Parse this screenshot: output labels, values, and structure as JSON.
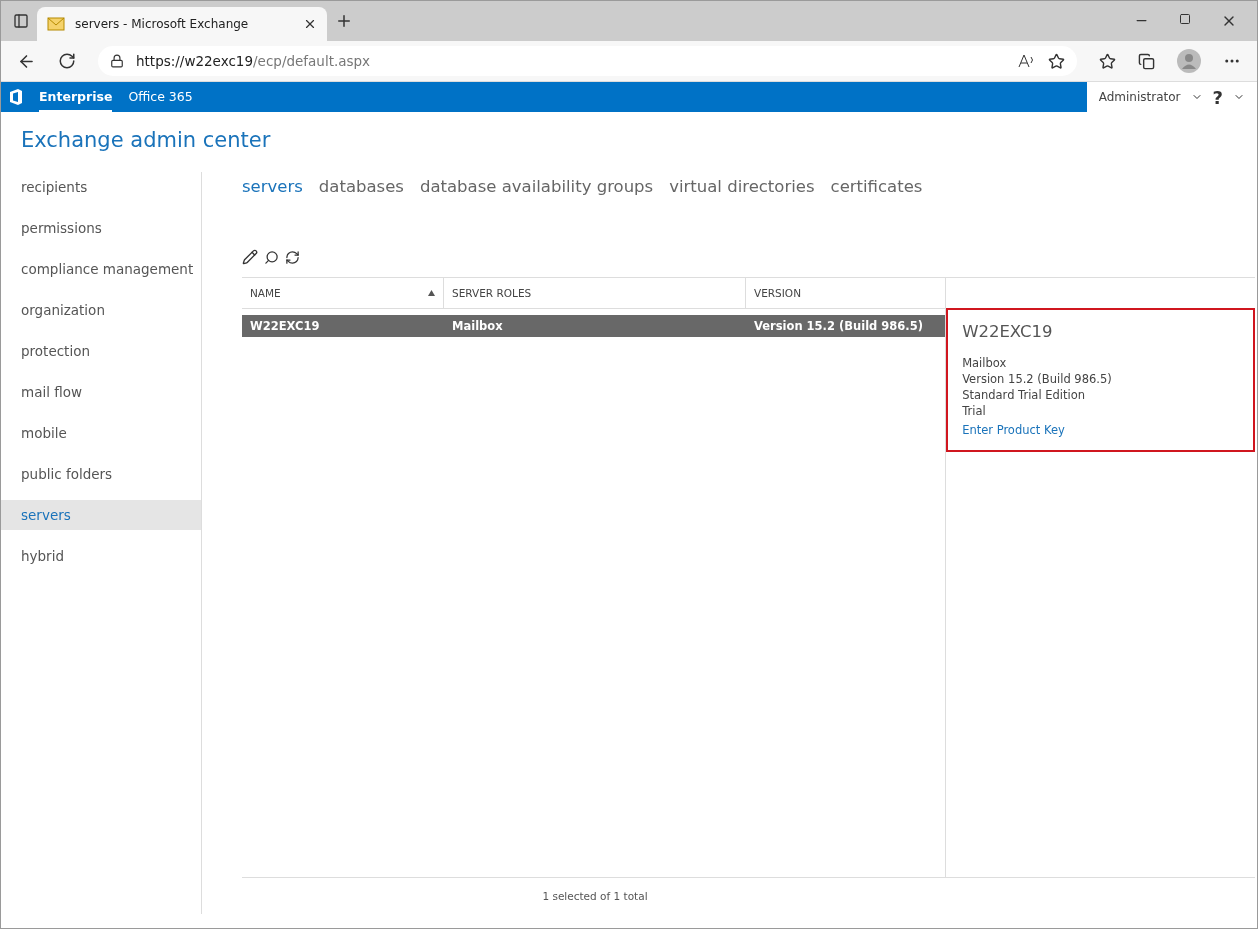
{
  "browser": {
    "tab_title": "servers - Microsoft Exchange",
    "url_host": "https://w22exc19",
    "url_path": "/ecp/default.aspx"
  },
  "suite_bar": {
    "links": [
      {
        "label": "Enterprise",
        "selected": true
      },
      {
        "label": "Office 365",
        "selected": false
      }
    ],
    "user": "Administrator",
    "help": "?"
  },
  "app_title": "Exchange admin center",
  "sidebar": {
    "items": [
      {
        "label": "recipients",
        "selected": false
      },
      {
        "label": "permissions",
        "selected": false
      },
      {
        "label": "compliance management",
        "selected": false
      },
      {
        "label": "organization",
        "selected": false
      },
      {
        "label": "protection",
        "selected": false
      },
      {
        "label": "mail flow",
        "selected": false
      },
      {
        "label": "mobile",
        "selected": false
      },
      {
        "label": "public folders",
        "selected": false
      },
      {
        "label": "servers",
        "selected": true
      },
      {
        "label": "hybrid",
        "selected": false
      }
    ]
  },
  "tabs": [
    {
      "label": "servers",
      "selected": true
    },
    {
      "label": "databases",
      "selected": false
    },
    {
      "label": "database availability groups",
      "selected": false
    },
    {
      "label": "virtual directories",
      "selected": false
    },
    {
      "label": "certificates",
      "selected": false
    }
  ],
  "table": {
    "columns": [
      {
        "label": "NAME",
        "sorted": true
      },
      {
        "label": "SERVER ROLES",
        "sorted": false
      },
      {
        "label": "VERSION",
        "sorted": false
      }
    ],
    "rows": [
      {
        "cells": [
          "W22EXC19",
          "Mailbox",
          "Version 15.2 (Build 986.5)"
        ],
        "selected": true
      }
    ]
  },
  "details": {
    "highlighted": true,
    "title": "W22EXC19",
    "lines": [
      "Mailbox",
      "Version 15.2 (Build 986.5)",
      "Standard Trial Edition",
      "Trial"
    ],
    "link": "Enter Product Key"
  },
  "status": "1 selected of 1 total"
}
